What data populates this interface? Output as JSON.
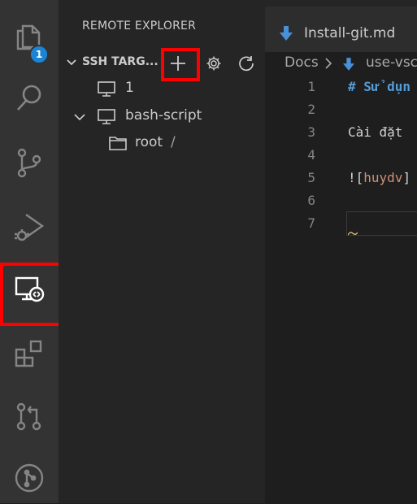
{
  "activity_bar": {
    "items": [
      {
        "name": "explorer",
        "icon": "files-icon",
        "badge": "1"
      },
      {
        "name": "search",
        "icon": "search-icon"
      },
      {
        "name": "source-control",
        "icon": "source-control-icon"
      },
      {
        "name": "run-debug",
        "icon": "run-debug-icon"
      },
      {
        "name": "remote-explorer",
        "icon": "remote-explorer-icon",
        "active": true
      },
      {
        "name": "extensions",
        "icon": "extensions-icon"
      },
      {
        "name": "pull-requests",
        "icon": "pull-request-icon"
      },
      {
        "name": "git-graph",
        "icon": "git-graph-icon"
      }
    ]
  },
  "sidebar": {
    "title": "REMOTE EXPLORER",
    "section": {
      "label": "SSH TARG...",
      "actions": [
        "add-icon",
        "gear-icon",
        "refresh-icon"
      ]
    },
    "tree": [
      {
        "label": "1",
        "icon": "monitor-icon",
        "level": 1
      },
      {
        "label": "bash-script",
        "icon": "monitor-icon",
        "level": 1,
        "expanded": true
      },
      {
        "label": "root",
        "suffix": "/",
        "icon": "folder-icon",
        "level": 2
      }
    ]
  },
  "editor": {
    "tab": {
      "label": "Install-git.md",
      "icon": "markdown-arrow-icon"
    },
    "breadcrumb": {
      "folder": "Docs",
      "separator": "›",
      "file": "use-vsc"
    },
    "lines": [
      {
        "num": "1",
        "text": "# Sử dụn",
        "color": "#569cd6"
      },
      {
        "num": "2",
        "text": ""
      },
      {
        "num": "3",
        "text": "Cài đặt",
        "color": "#d4d4d4"
      },
      {
        "num": "4",
        "text": ""
      },
      {
        "num": "5",
        "text_a": "![",
        "text_b": "huydv",
        "text_c": "]"
      },
      {
        "num": "6",
        "text": ""
      },
      {
        "num": "7",
        "text": ""
      }
    ]
  },
  "colors": {
    "highlight": "#ff0000",
    "accent": "#1a85d6",
    "heading": "#569cd6",
    "link": "#ce9178",
    "squiggle": "#d7ba7d"
  }
}
